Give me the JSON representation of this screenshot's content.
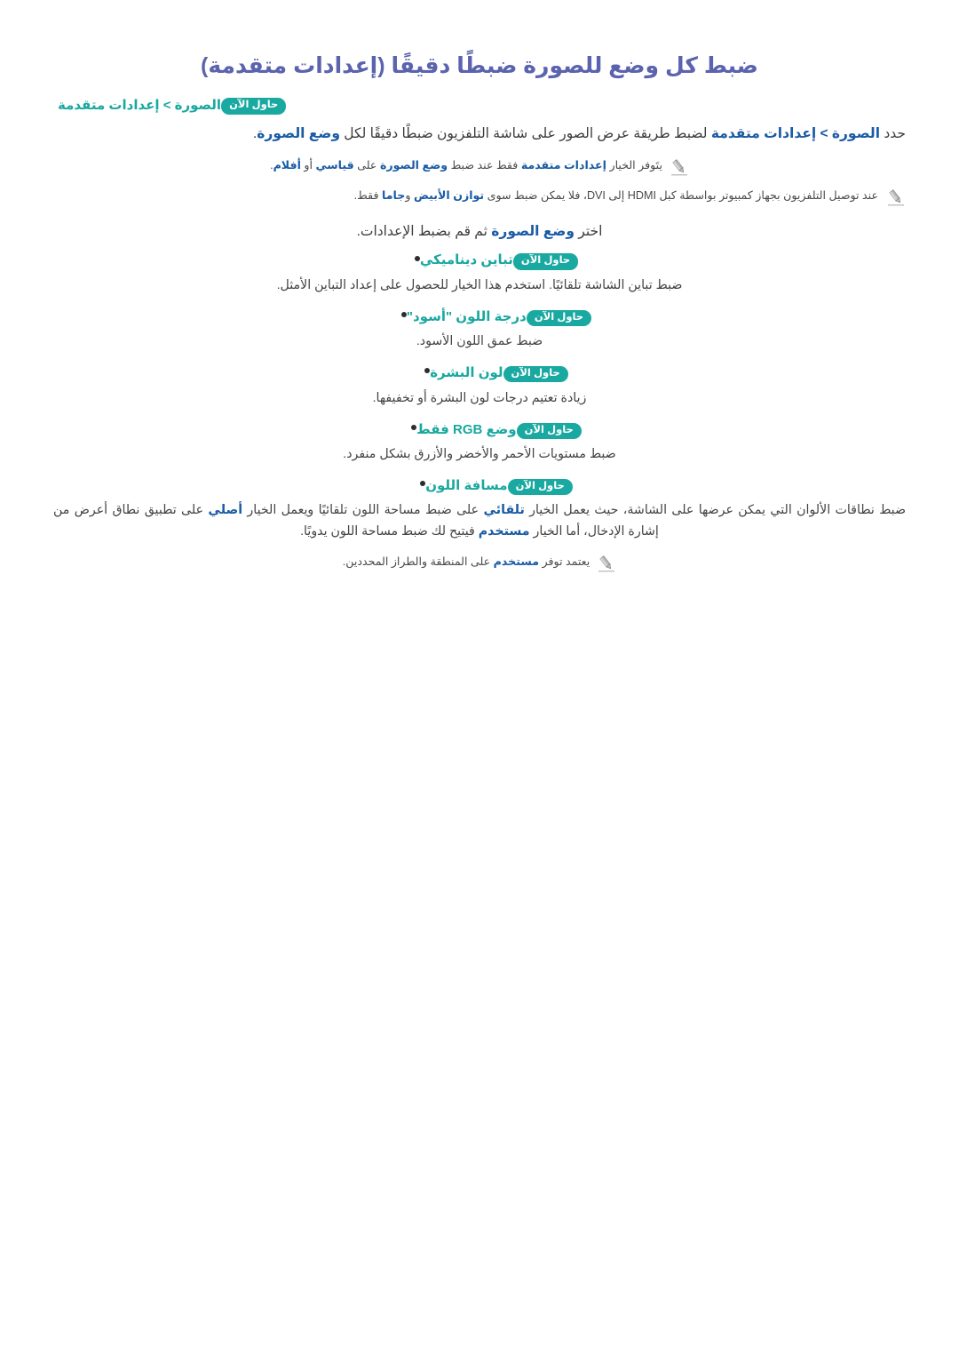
{
  "title": "ضبط كل وضع للصورة ضبطًا دقيقًا (إعدادات متقدمة)",
  "try_now_label": "حاول الآن",
  "breadcrumb": {
    "path": "الصورة > إعدادات متقدمة"
  },
  "lead": {
    "pre": "حدد ",
    "link1": "الصورة > إعدادات متقدمة",
    "mid": " لضبط طريقة عرض الصور على شاشة التلفزيون ضبطًا دقيقًا لكل ",
    "link2": "وضع الصورة",
    "post": "."
  },
  "notes_top": [
    {
      "icon": "pencil-icon",
      "seg1": "يتَوفر الخيار ",
      "hl1": "إعدادات متقدمة",
      "seg2": " فقط عند ضبط ",
      "hl2": "وضع الصورة",
      "seg3": " على ",
      "hl3": "قياسي",
      "seg4": " أو ",
      "hl4": "أفلام",
      "seg5": "."
    },
    {
      "icon": "pencil-icon",
      "seg1": "عند توصيل التلفزيون بجهاز كمبيوتر بواسطة كبل HDMI إلى DVI، فلا يمكن ضبط سوى ",
      "hl1": "توازن الأبيض",
      "seg2": " و",
      "hl2": "جاما",
      "seg3": " فقط."
    }
  ],
  "instruction": {
    "pre": "اختر ",
    "hl": "وضع الصورة",
    "post": " ثم قم بضبط الإعدادات."
  },
  "bullets": [
    {
      "title": "تباين ديناميكي",
      "badge": "حاول الآن",
      "desc": "ضبط تباين الشاشة تلقائيًا. استخدم هذا الخيار للحصول على إعداد التباين الأمثل."
    },
    {
      "title": "درجة اللون \"أسود\"",
      "badge": "حاول الآن",
      "desc": "ضبط عمق اللون الأسود."
    },
    {
      "title": "لون البشرة",
      "badge": "حاول الآن",
      "desc": "زيادة تعتيم درجات لون البشرة أو تخفيفها."
    },
    {
      "title": "وضع RGB فقط",
      "badge": "حاول الآن",
      "desc": "ضبط مستويات الأحمر والأخضر والأزرق بشكل منفرد."
    },
    {
      "title": "مسافة اللون",
      "badge": "حاول الآن",
      "desc_seg1": "ضبط نطاقات الألوان التي يمكن عرضها على الشاشة، حيث يعمل الخيار ",
      "desc_hl1": "تلقائي",
      "desc_seg2": " على ضبط مساحة اللون تلقائيًا ويعمل الخيار ",
      "desc_hl2": "أصلي",
      "desc_seg3": " على تطبيق نطاق أعرض من إشارة الإدخال، أما الخيار ",
      "desc_hl3": "مستخدم",
      "desc_seg4": " فيتيح لك ضبط مساحة اللون يدويًا."
    }
  ],
  "note_bottom": {
    "icon": "pencil-icon",
    "seg1": "يعتمد توفر ",
    "hl1": "مستخدم",
    "seg2": " على المنطقة والطراز المحددين."
  },
  "colors": {
    "title": "#5b63ae",
    "accent_teal": "#19a8a0",
    "link_blue": "#1a5ba5",
    "body_text": "#3c3c3c",
    "note_text": "#4a4a4a",
    "pencil_icon": "#9a9a9a",
    "background": "#ffffff"
  }
}
